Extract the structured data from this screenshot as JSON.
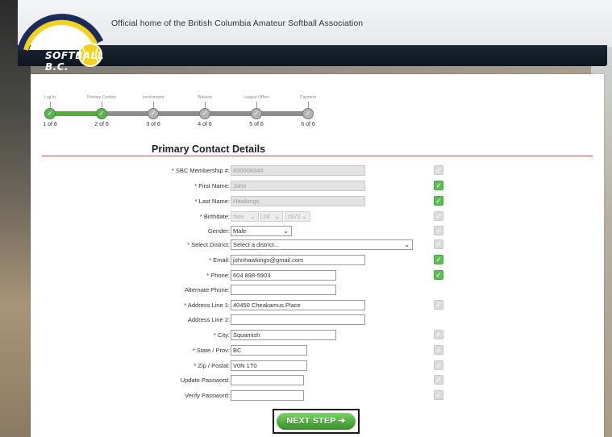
{
  "header": {
    "tagline": "Official home of the British Columbia Amateur Softball Association",
    "logo_text": "SOFTBALL B.C."
  },
  "progress": {
    "steps": [
      {
        "label": "Log In",
        "count": "1 of 6",
        "done": true
      },
      {
        "label": "Primary Contact",
        "count": "2 of 6",
        "done": true
      },
      {
        "label": "Involvement",
        "count": "3 of 6",
        "done": false
      },
      {
        "label": "Waivers",
        "count": "4 of 6",
        "done": false
      },
      {
        "label": "League Offers",
        "count": "5 of 6",
        "done": false
      },
      {
        "label": "Payment",
        "count": "6 of 6",
        "done": false
      }
    ],
    "current_step": 2,
    "total_steps": 6
  },
  "form": {
    "title": "Primary Contact Details",
    "membership": {
      "label": "* SBC Membership #:",
      "value": "600008340"
    },
    "first_name": {
      "label": "* First Name:",
      "value": "John"
    },
    "last_name": {
      "label": "* Last Name:",
      "value": "Hawkings"
    },
    "birthdate": {
      "label": "* Birthdate:",
      "month": "Nov",
      "day": "24",
      "year": "1972"
    },
    "gender": {
      "label": "Gender:",
      "value": "Male"
    },
    "district": {
      "label": "* Select District:",
      "value": "Select a district..."
    },
    "email": {
      "label": "* Email:",
      "value": "johnhawkings@gmail.com"
    },
    "phone": {
      "label": "* Phone:",
      "value": "604 898-5903"
    },
    "alt_phone": {
      "label": "Alternate Phone:",
      "value": ""
    },
    "address1": {
      "label": "* Address Line 1:",
      "value": "40450 Cheakamus Place"
    },
    "address2": {
      "label": "Address Line 2:",
      "value": ""
    },
    "city": {
      "label": "* City:",
      "value": "Squamish"
    },
    "state": {
      "label": "* State / Prov:",
      "value": "BC"
    },
    "zip": {
      "label": "* Zip / Postal:",
      "value": "V0N 1T0"
    },
    "update_password": {
      "label": "Update Password:",
      "value": ""
    },
    "verify_password": {
      "label": "Verify Password:",
      "value": ""
    },
    "next_label": "NEXT STEP"
  },
  "icons": {
    "check": "check-icon",
    "chevron": "chevron-down-icon",
    "arrow": "arrow-right-icon"
  },
  "colors": {
    "accent_green": "#5fbf57",
    "rule_red": "#d9534f",
    "header_navy": "#0d1520",
    "logo_yellow": "#f2d21b"
  }
}
